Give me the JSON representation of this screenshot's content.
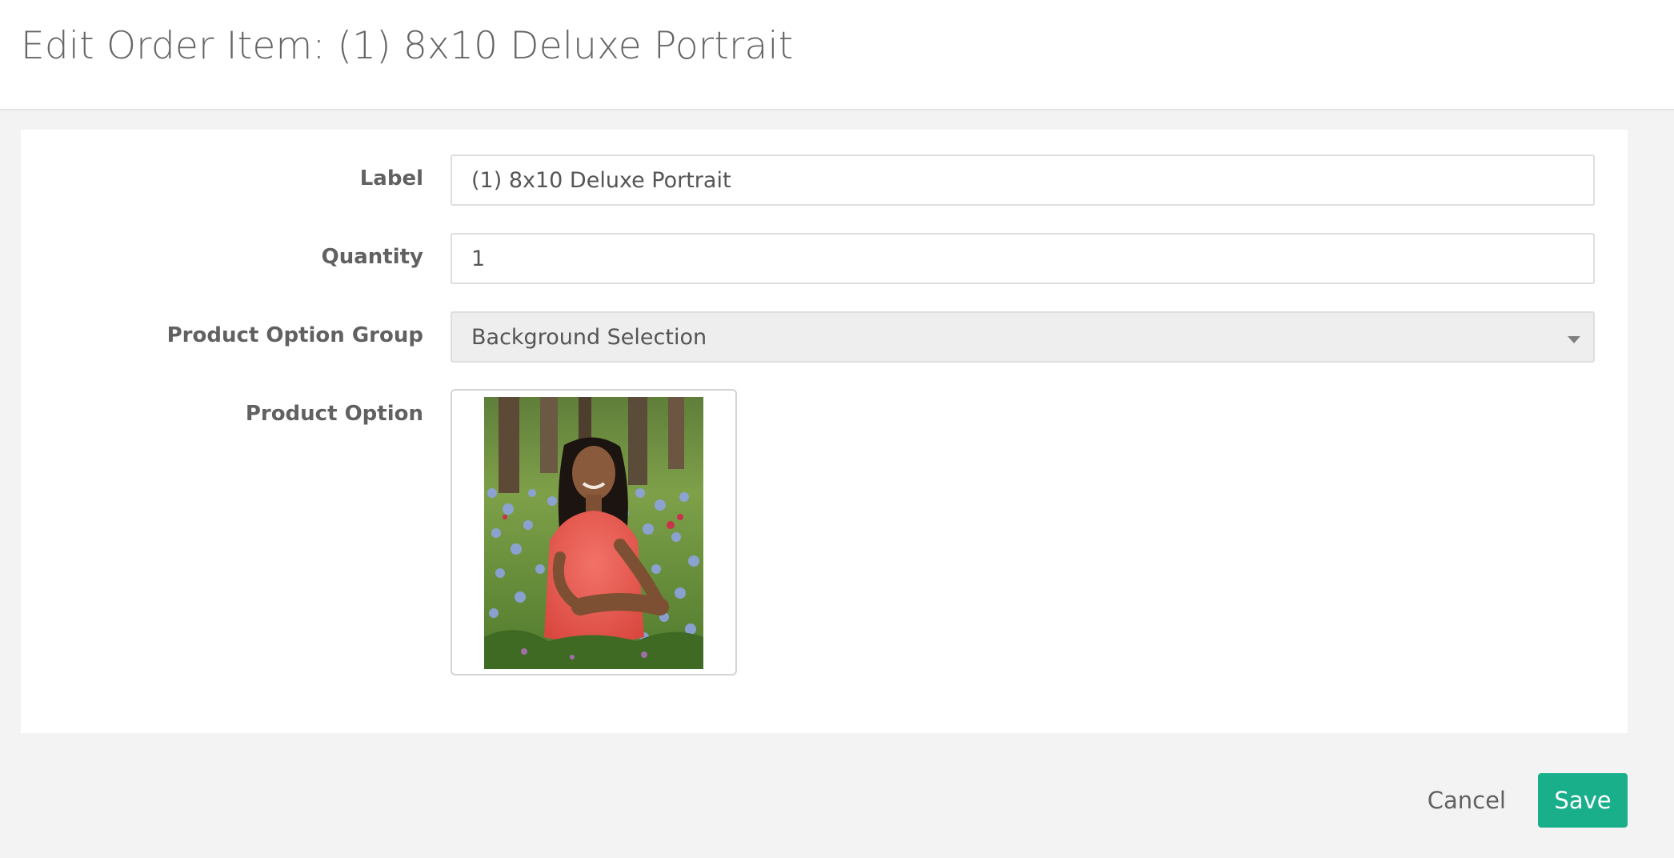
{
  "header": {
    "title": "Edit Order Item: (1) 8x10 Deluxe Portrait"
  },
  "form": {
    "label": {
      "label": "Label",
      "value": "(1) 8x10 Deluxe Portrait"
    },
    "quantity": {
      "label": "Quantity",
      "value": "1"
    },
    "product_option_group": {
      "label": "Product Option Group",
      "selected": "Background Selection"
    },
    "product_option": {
      "label": "Product Option",
      "image_alt": "portrait-photo-girl-in-flower-field"
    }
  },
  "footer": {
    "cancel_label": "Cancel",
    "save_label": "Save"
  },
  "colors": {
    "accent": "#1aaf8b",
    "background": "#f3f3f3",
    "card": "#ffffff"
  }
}
